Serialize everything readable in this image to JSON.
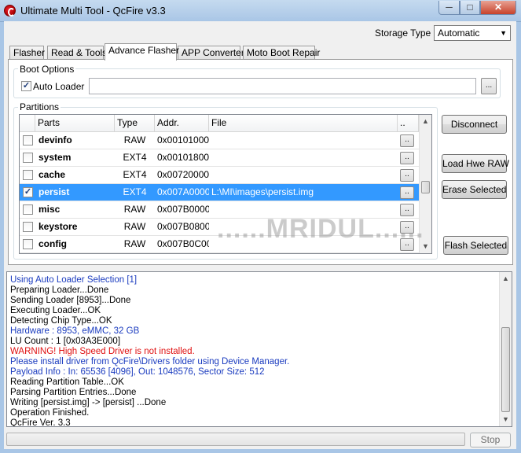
{
  "window": {
    "title": "Ultimate Multi Tool - QcFire v3.3",
    "min_glyph": "─",
    "max_glyph": "□",
    "close_glyph": "✕"
  },
  "storage": {
    "label": "Storage Type",
    "value": "Automatic"
  },
  "tabs": [
    {
      "label": "Flasher",
      "active": false
    },
    {
      "label": "Read & Tools",
      "active": false
    },
    {
      "label": "Advance Flasher",
      "active": true
    },
    {
      "label": "APP Converter",
      "active": false
    },
    {
      "label": "Moto Boot Repair",
      "active": false
    }
  ],
  "boot_options": {
    "title": "Boot Options",
    "auto_loader_label": "Auto Loader",
    "auto_loader_checked": true,
    "loader_path": "",
    "browse_label": "..."
  },
  "partitions": {
    "title": "Partitions",
    "columns": [
      "Parts",
      "Type",
      "Addr.",
      "File",
      ".."
    ],
    "rows": [
      {
        "checked": false,
        "part": "devinfo",
        "type": "RAW",
        "addr": "0x00101000",
        "file": "",
        "btn": "..",
        "selected": false
      },
      {
        "checked": false,
        "part": "system",
        "type": "EXT4",
        "addr": "0x00101800",
        "file": "",
        "btn": "..",
        "selected": false
      },
      {
        "checked": false,
        "part": "cache",
        "type": "EXT4",
        "addr": "0x00720000",
        "file": "",
        "btn": "..",
        "selected": false
      },
      {
        "checked": true,
        "part": "persist",
        "type": "EXT4",
        "addr": "0x007A0000",
        "file": "L:\\MI\\images\\persist.img",
        "btn": "..",
        "selected": true
      },
      {
        "checked": false,
        "part": "misc",
        "type": "RAW",
        "addr": "0x007B0000",
        "file": "",
        "btn": "..",
        "selected": false
      },
      {
        "checked": false,
        "part": "keystore",
        "type": "RAW",
        "addr": "0x007B0800",
        "file": "",
        "btn": "..",
        "selected": false
      },
      {
        "checked": false,
        "part": "config",
        "type": "RAW",
        "addr": "0x007B0C00",
        "file": "",
        "btn": "..",
        "selected": false
      }
    ]
  },
  "buttons": {
    "disconnect": "Disconnect",
    "load_hwe_raw": "Load Hwe RAW",
    "erase_selected": "Erase Selected",
    "flash_selected": "Flash Selected",
    "stop": "Stop"
  },
  "watermark": "......MRIDUL......",
  "log": [
    {
      "text": "Using Auto Loader Selection [1]",
      "color": "blue"
    },
    {
      "text": "Preparing Loader...Done",
      "color": "black"
    },
    {
      "text": "Sending Loader [8953]...Done",
      "color": "black"
    },
    {
      "text": "Executing Loader...OK",
      "color": "black"
    },
    {
      "text": "Detecting Chip Type...OK",
      "color": "black"
    },
    {
      "text": "Hardware      : 8953, eMMC, 32 GB",
      "color": "blue"
    },
    {
      "text": "LU Count      : 1 [0x03A3E000]",
      "color": "black"
    },
    {
      "text": "WARNING! High Speed Driver is not installed.",
      "color": "red"
    },
    {
      "text": "Please install driver from QcFire\\Drivers folder using Device Manager.",
      "color": "blue"
    },
    {
      "text": "Payload Info  : In: 65536 [4096], Out: 1048576, Sector Size: 512",
      "color": "blue"
    },
    {
      "text": "Reading Partition Table...OK",
      "color": "black"
    },
    {
      "text": "Parsing Partition Entries...Done",
      "color": "black"
    },
    {
      "text": "Writing [persist.img] -> [persist]  ...Done",
      "color": "black"
    },
    {
      "text": "Operation Finished.",
      "color": "black"
    },
    {
      "text": "QcFire Ver. 3.3",
      "color": "black"
    }
  ],
  "progress": 0
}
